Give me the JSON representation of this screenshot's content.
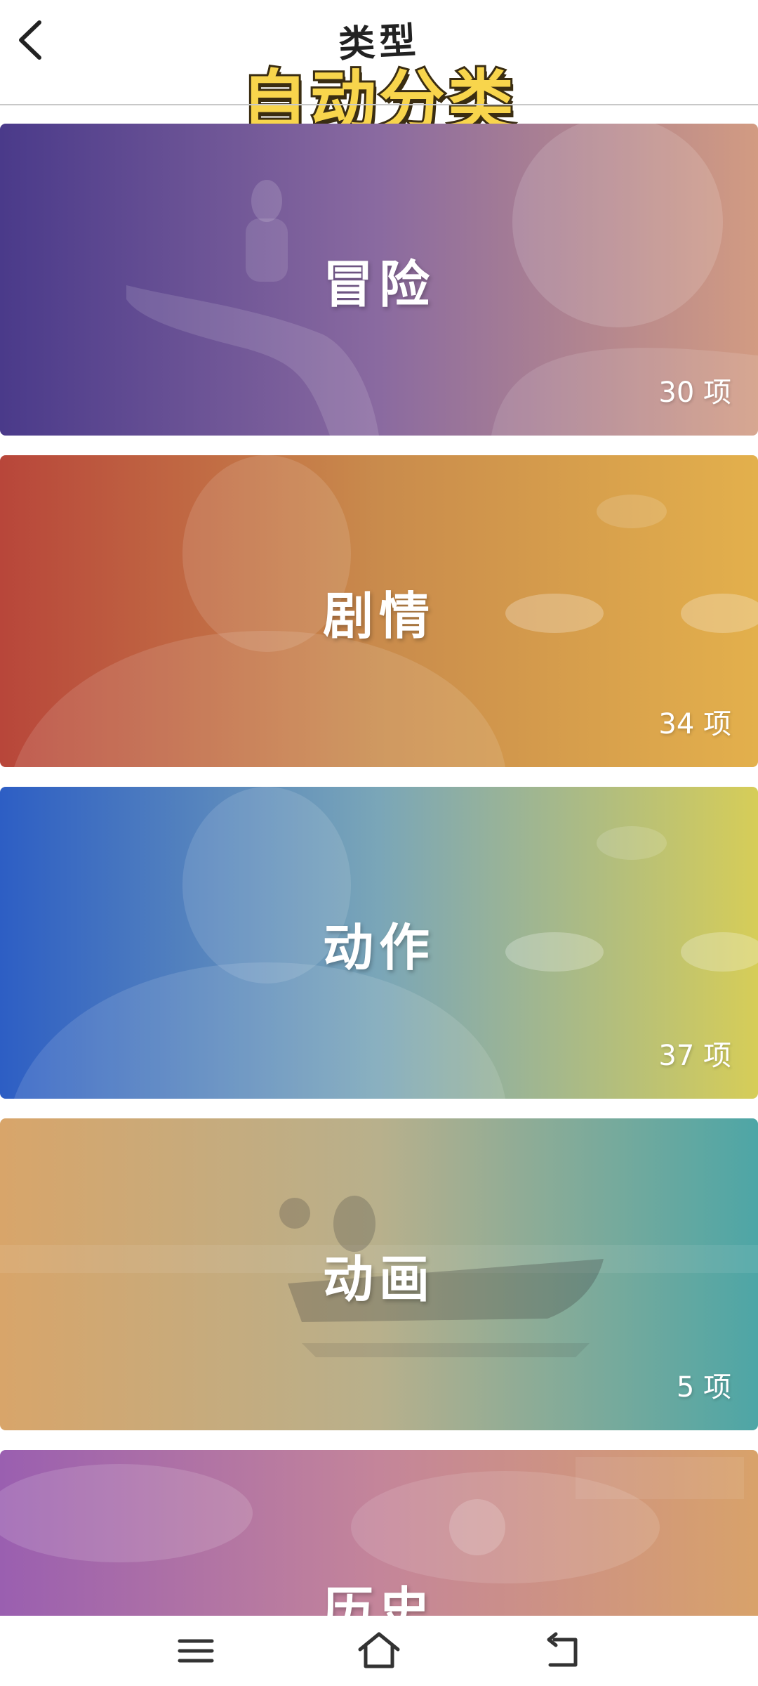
{
  "header": {
    "title": "类型",
    "overlay_caption": "自动分类"
  },
  "categories": [
    {
      "label": "冒险",
      "count": "30 项",
      "gradient": [
        "#4a3a8a",
        "#8a6aa0",
        "#d29b82"
      ]
    },
    {
      "label": "剧情",
      "count": "34 项",
      "gradient": [
        "#b8463a",
        "#c98b4c",
        "#e3b04c"
      ]
    },
    {
      "label": "动作",
      "count": "37 项",
      "gradient": [
        "#2d5ec4",
        "#7aa6b8",
        "#d6cd58"
      ]
    },
    {
      "label": "动画",
      "count": "5 项",
      "gradient": [
        "#d8a56a",
        "#b8b08c",
        "#4ea6a6"
      ]
    },
    {
      "label": "历史",
      "count": "",
      "gradient": [
        "#9a5fb0",
        "#c4859a",
        "#d8a26a"
      ]
    }
  ],
  "icons": {
    "back": "chevron-left-icon",
    "menu": "menu-icon",
    "home": "home-icon",
    "return": "return-icon"
  }
}
